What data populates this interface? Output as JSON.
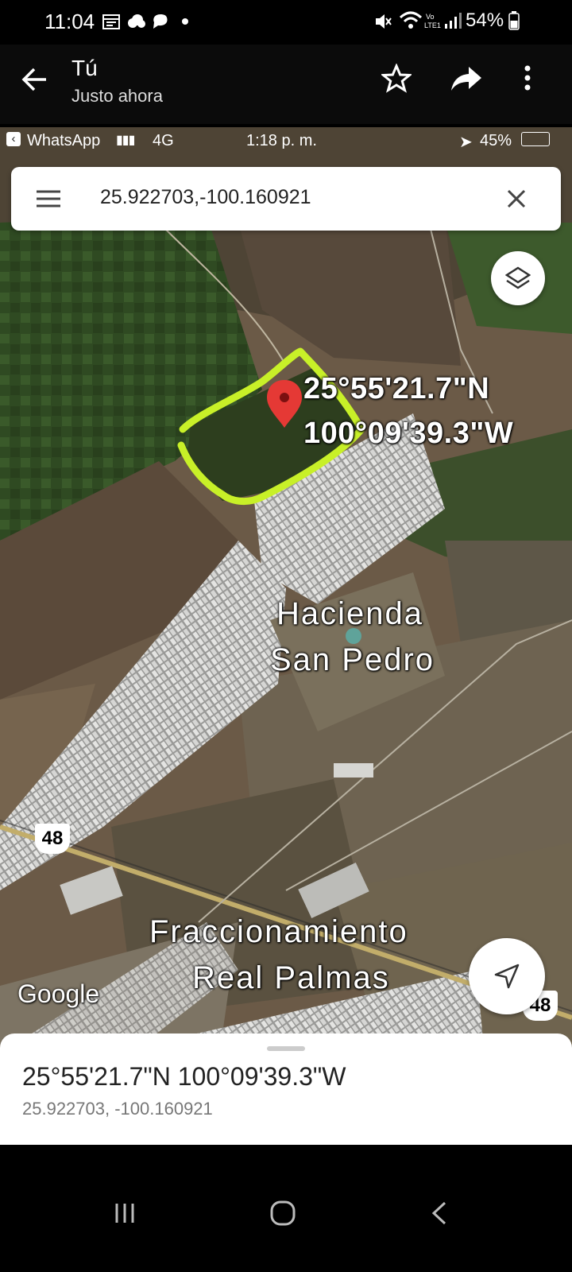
{
  "status_bar": {
    "time": "11:04",
    "battery": "54%",
    "icons": [
      "calendar-icon",
      "cloud-icon",
      "chat-icon",
      "dot-icon",
      "mute-icon",
      "wifi-icon",
      "volte-icon",
      "signal-icon",
      "battery-icon"
    ]
  },
  "viewer_header": {
    "title": "Tú",
    "subtitle": "Justo ahora",
    "icons": [
      "back-arrow-icon",
      "star-icon",
      "share-icon",
      "more-vertical-icon"
    ]
  },
  "inner_status": {
    "back_app": "WhatsApp",
    "network": "4G",
    "time": "1:18 p. m.",
    "battery": "45%"
  },
  "map_app": {
    "search_query": "25.922703,-100.160921",
    "pin_label_lat": "25°55'21.7\"N",
    "pin_label_lon": "100°09'39.3\"W",
    "place_1_line1": "Hacienda",
    "place_1_line2": "San Pedro",
    "place_2_line1": "Fraccionamiento",
    "place_2_line2": "Real Palmas",
    "road_shield_1": "48",
    "road_shield_2": "48",
    "logo": "Google",
    "highlight_color": "#c8f028",
    "pin_color": "#e53935"
  },
  "bottom_sheet": {
    "dms": "25°55'21.7\"N 100°09'39.3\"W",
    "decimal": "25.922703, -100.160921"
  }
}
